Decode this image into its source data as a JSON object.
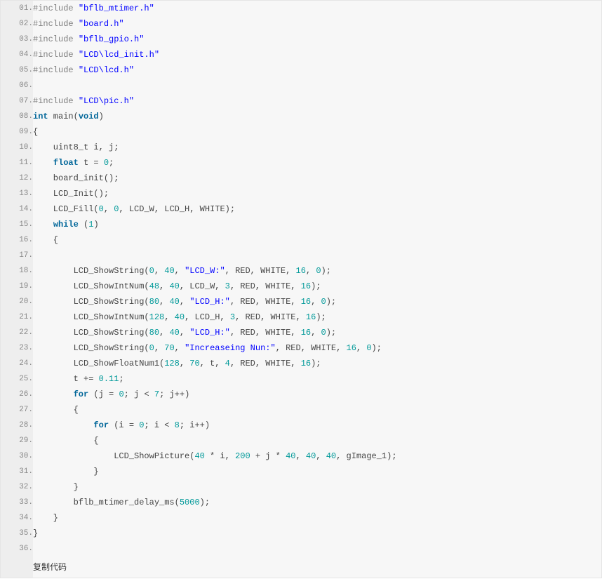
{
  "copy_label": "复制代码",
  "lines": [
    {
      "num": "01.",
      "tokens": [
        [
          "pp",
          "#include "
        ],
        [
          "str",
          "\"bflb_mtimer.h\""
        ]
      ]
    },
    {
      "num": "02.",
      "tokens": [
        [
          "pp",
          "#include "
        ],
        [
          "str",
          "\"board.h\""
        ]
      ]
    },
    {
      "num": "03.",
      "tokens": [
        [
          "pp",
          "#include "
        ],
        [
          "str",
          "\"bflb_gpio.h\""
        ]
      ]
    },
    {
      "num": "04.",
      "tokens": [
        [
          "pp",
          "#include "
        ],
        [
          "str",
          "\"LCD\\lcd_init.h\""
        ]
      ]
    },
    {
      "num": "05.",
      "tokens": [
        [
          "pp",
          "#include "
        ],
        [
          "str",
          "\"LCD\\lcd.h\""
        ]
      ]
    },
    {
      "num": "06.",
      "tokens": []
    },
    {
      "num": "07.",
      "tokens": [
        [
          "pp",
          "#include "
        ],
        [
          "str",
          "\"LCD\\pic.h\""
        ]
      ]
    },
    {
      "num": "08.",
      "tokens": [
        [
          "type",
          "int"
        ],
        [
          "plain",
          " main("
        ],
        [
          "type",
          "void"
        ],
        [
          "plain",
          ")"
        ]
      ]
    },
    {
      "num": "09.",
      "tokens": [
        [
          "plain",
          "{"
        ]
      ]
    },
    {
      "num": "10.",
      "tokens": [
        [
          "plain",
          "    uint8_t i, j;"
        ]
      ]
    },
    {
      "num": "11.",
      "tokens": [
        [
          "plain",
          "    "
        ],
        [
          "type",
          "float"
        ],
        [
          "plain",
          " t = "
        ],
        [
          "num",
          "0"
        ],
        [
          "plain",
          ";"
        ]
      ]
    },
    {
      "num": "12.",
      "tokens": [
        [
          "plain",
          "    board_init();"
        ]
      ]
    },
    {
      "num": "13.",
      "tokens": [
        [
          "plain",
          "    LCD_Init();"
        ]
      ]
    },
    {
      "num": "14.",
      "tokens": [
        [
          "plain",
          "    LCD_Fill("
        ],
        [
          "num",
          "0"
        ],
        [
          "plain",
          ", "
        ],
        [
          "num",
          "0"
        ],
        [
          "plain",
          ", LCD_W, LCD_H, WHITE);"
        ]
      ]
    },
    {
      "num": "15.",
      "tokens": [
        [
          "plain",
          "    "
        ],
        [
          "kw",
          "while"
        ],
        [
          "plain",
          " ("
        ],
        [
          "num",
          "1"
        ],
        [
          "plain",
          ")"
        ]
      ]
    },
    {
      "num": "16.",
      "tokens": [
        [
          "plain",
          "    {"
        ]
      ]
    },
    {
      "num": "17.",
      "tokens": []
    },
    {
      "num": "18.",
      "tokens": [
        [
          "plain",
          "        LCD_ShowString("
        ],
        [
          "num",
          "0"
        ],
        [
          "plain",
          ", "
        ],
        [
          "num",
          "40"
        ],
        [
          "plain",
          ", "
        ],
        [
          "str",
          "\"LCD_W:\""
        ],
        [
          "plain",
          ", RED, WHITE, "
        ],
        [
          "num",
          "16"
        ],
        [
          "plain",
          ", "
        ],
        [
          "num",
          "0"
        ],
        [
          "plain",
          ");"
        ]
      ]
    },
    {
      "num": "19.",
      "tokens": [
        [
          "plain",
          "        LCD_ShowIntNum("
        ],
        [
          "num",
          "48"
        ],
        [
          "plain",
          ", "
        ],
        [
          "num",
          "40"
        ],
        [
          "plain",
          ", LCD_W, "
        ],
        [
          "num",
          "3"
        ],
        [
          "plain",
          ", RED, WHITE, "
        ],
        [
          "num",
          "16"
        ],
        [
          "plain",
          ");"
        ]
      ]
    },
    {
      "num": "20.",
      "tokens": [
        [
          "plain",
          "        LCD_ShowString("
        ],
        [
          "num",
          "80"
        ],
        [
          "plain",
          ", "
        ],
        [
          "num",
          "40"
        ],
        [
          "plain",
          ", "
        ],
        [
          "str",
          "\"LCD_H:\""
        ],
        [
          "plain",
          ", RED, WHITE, "
        ],
        [
          "num",
          "16"
        ],
        [
          "plain",
          ", "
        ],
        [
          "num",
          "0"
        ],
        [
          "plain",
          ");"
        ]
      ]
    },
    {
      "num": "21.",
      "tokens": [
        [
          "plain",
          "        LCD_ShowIntNum("
        ],
        [
          "num",
          "128"
        ],
        [
          "plain",
          ", "
        ],
        [
          "num",
          "40"
        ],
        [
          "plain",
          ", LCD_H, "
        ],
        [
          "num",
          "3"
        ],
        [
          "plain",
          ", RED, WHITE, "
        ],
        [
          "num",
          "16"
        ],
        [
          "plain",
          ");"
        ]
      ]
    },
    {
      "num": "22.",
      "tokens": [
        [
          "plain",
          "        LCD_ShowString("
        ],
        [
          "num",
          "80"
        ],
        [
          "plain",
          ", "
        ],
        [
          "num",
          "40"
        ],
        [
          "plain",
          ", "
        ],
        [
          "str",
          "\"LCD_H:\""
        ],
        [
          "plain",
          ", RED, WHITE, "
        ],
        [
          "num",
          "16"
        ],
        [
          "plain",
          ", "
        ],
        [
          "num",
          "0"
        ],
        [
          "plain",
          ");"
        ]
      ]
    },
    {
      "num": "23.",
      "tokens": [
        [
          "plain",
          "        LCD_ShowString("
        ],
        [
          "num",
          "0"
        ],
        [
          "plain",
          ", "
        ],
        [
          "num",
          "70"
        ],
        [
          "plain",
          ", "
        ],
        [
          "str",
          "\"Increaseing Nun:\""
        ],
        [
          "plain",
          ", RED, WHITE, "
        ],
        [
          "num",
          "16"
        ],
        [
          "plain",
          ", "
        ],
        [
          "num",
          "0"
        ],
        [
          "plain",
          ");"
        ]
      ]
    },
    {
      "num": "24.",
      "tokens": [
        [
          "plain",
          "        LCD_ShowFloatNum1("
        ],
        [
          "num",
          "128"
        ],
        [
          "plain",
          ", "
        ],
        [
          "num",
          "70"
        ],
        [
          "plain",
          ", t, "
        ],
        [
          "num",
          "4"
        ],
        [
          "plain",
          ", RED, WHITE, "
        ],
        [
          "num",
          "16"
        ],
        [
          "plain",
          ");"
        ]
      ]
    },
    {
      "num": "25.",
      "tokens": [
        [
          "plain",
          "        t += "
        ],
        [
          "num",
          "0.11"
        ],
        [
          "plain",
          ";"
        ]
      ]
    },
    {
      "num": "26.",
      "tokens": [
        [
          "plain",
          "        "
        ],
        [
          "kw",
          "for"
        ],
        [
          "plain",
          " (j = "
        ],
        [
          "num",
          "0"
        ],
        [
          "plain",
          "; j < "
        ],
        [
          "num",
          "7"
        ],
        [
          "plain",
          "; j++)"
        ]
      ]
    },
    {
      "num": "27.",
      "tokens": [
        [
          "plain",
          "        {"
        ]
      ]
    },
    {
      "num": "28.",
      "tokens": [
        [
          "plain",
          "            "
        ],
        [
          "kw",
          "for"
        ],
        [
          "plain",
          " (i = "
        ],
        [
          "num",
          "0"
        ],
        [
          "plain",
          "; i < "
        ],
        [
          "num",
          "8"
        ],
        [
          "plain",
          "; i++)"
        ]
      ]
    },
    {
      "num": "29.",
      "tokens": [
        [
          "plain",
          "            {"
        ]
      ]
    },
    {
      "num": "30.",
      "tokens": [
        [
          "plain",
          "                LCD_ShowPicture("
        ],
        [
          "num",
          "40"
        ],
        [
          "plain",
          " * i, "
        ],
        [
          "num",
          "200"
        ],
        [
          "plain",
          " + j * "
        ],
        [
          "num",
          "40"
        ],
        [
          "plain",
          ", "
        ],
        [
          "num",
          "40"
        ],
        [
          "plain",
          ", "
        ],
        [
          "num",
          "40"
        ],
        [
          "plain",
          ", gImage_1);"
        ]
      ]
    },
    {
      "num": "31.",
      "tokens": [
        [
          "plain",
          "            }"
        ]
      ]
    },
    {
      "num": "32.",
      "tokens": [
        [
          "plain",
          "        }"
        ]
      ]
    },
    {
      "num": "33.",
      "tokens": [
        [
          "plain",
          "        bflb_mtimer_delay_ms("
        ],
        [
          "num",
          "5000"
        ],
        [
          "plain",
          ");"
        ]
      ]
    },
    {
      "num": "34.",
      "tokens": [
        [
          "plain",
          "    }"
        ]
      ]
    },
    {
      "num": "35.",
      "tokens": [
        [
          "plain",
          "}"
        ]
      ]
    },
    {
      "num": "36.",
      "tokens": []
    }
  ]
}
